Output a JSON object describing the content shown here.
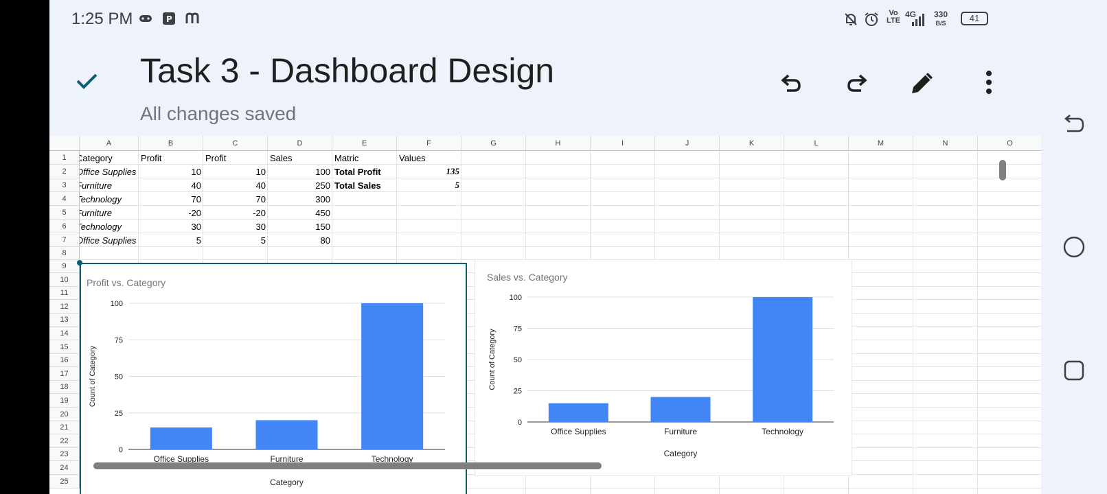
{
  "status_bar": {
    "time": "1:25 PM",
    "network": "4G",
    "volte": "Vo",
    "volte_sub": "LTE",
    "speed_value": "330",
    "speed_unit": "B/S",
    "battery": "41",
    "left_icons": [
      "gamepad-icon",
      "publisher-p-icon",
      "m-app-icon"
    ],
    "right_icons": [
      "notifications-off-icon",
      "alarm-icon",
      "volte-icon",
      "signal-icon",
      "battery-icon"
    ]
  },
  "header": {
    "title": "Task 3 - Dashboard Design",
    "save_status": "All changes saved",
    "icons": [
      "check-icon",
      "undo-icon",
      "redo-icon",
      "pencil-icon",
      "more-vert-icon"
    ]
  },
  "sheet": {
    "columns": [
      "A",
      "B",
      "C",
      "D",
      "E",
      "F",
      "G",
      "H",
      "I",
      "J",
      "K",
      "L",
      "M",
      "N",
      "O"
    ],
    "rows": [
      "1",
      "2",
      "3",
      "4",
      "5",
      "6",
      "7",
      "8",
      "9",
      "10",
      "11",
      "12",
      "13",
      "14",
      "15",
      "16",
      "17",
      "18",
      "19",
      "20",
      "21",
      "22",
      "23",
      "24",
      "25"
    ],
    "cells": {
      "r1": [
        "Category",
        "Profit",
        "Profit",
        "Sales",
        "Matric",
        "Values"
      ],
      "r2": [
        "Office Supplies",
        "10",
        "10",
        "100",
        "Total Profit",
        "135"
      ],
      "r3": [
        "Furniture",
        "40",
        "40",
        "250",
        "Total Sales",
        "5"
      ],
      "r4": [
        "Technology",
        "70",
        "70",
        "300",
        "",
        ""
      ],
      "r5": [
        "Furniture",
        "-20",
        "-20",
        "450",
        "",
        ""
      ],
      "r6": [
        "Technology",
        "30",
        "30",
        "150",
        "",
        ""
      ],
      "r7": [
        "Office Supplies",
        "5",
        "5",
        "80",
        "",
        ""
      ]
    }
  },
  "chart_data": [
    {
      "type": "bar",
      "title": "Profit vs. Category",
      "xlabel": "Category",
      "ylabel": "Count of Category",
      "categories": [
        "Office Supplies",
        "Furniture",
        "Technology"
      ],
      "values": [
        15,
        20,
        100
      ],
      "ylim": [
        0,
        100
      ],
      "yticks": [
        "0",
        "25",
        "50",
        "75",
        "100"
      ],
      "color": "#4285f4",
      "grid": true
    },
    {
      "type": "bar",
      "title": "Sales vs. Category",
      "xlabel": "Category",
      "ylabel": "Count of Category",
      "categories": [
        "Office Supplies",
        "Furniture",
        "Technology"
      ],
      "values": [
        15,
        20,
        100
      ],
      "ylim": [
        0,
        100
      ],
      "yticks": [
        "0",
        "25",
        "50",
        "75",
        "100"
      ],
      "color": "#4285f4",
      "grid": true
    }
  ],
  "nav": {
    "icons": [
      "back-icon",
      "home-icon",
      "recents-icon"
    ]
  }
}
